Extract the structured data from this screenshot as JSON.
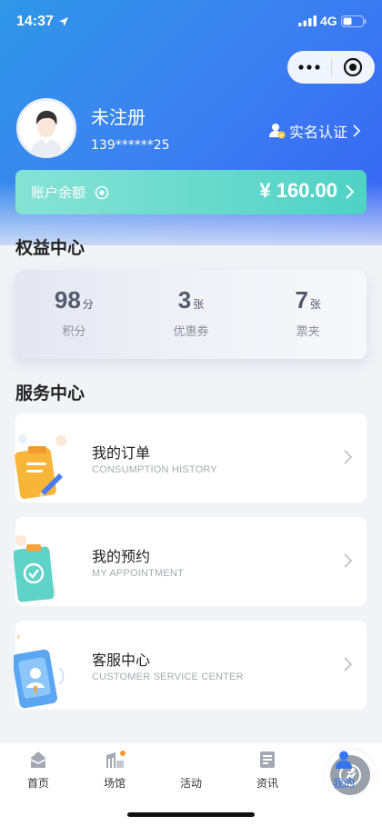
{
  "status_bar": {
    "time": "14:37",
    "network": "4G"
  },
  "user": {
    "name": "未注册",
    "phone": "139******25",
    "verify_label": "实名认证"
  },
  "balance": {
    "label": "账户余额",
    "amount": "¥ 160.00"
  },
  "rights": {
    "title": "权益中心",
    "stats": [
      {
        "value": "98",
        "unit": "分",
        "label": "积分"
      },
      {
        "value": "3",
        "unit": "张",
        "label": "优惠券"
      },
      {
        "value": "7",
        "unit": "张",
        "label": "票夹"
      }
    ]
  },
  "services": {
    "title": "服务中心",
    "items": [
      {
        "title": "我的订单",
        "subtitle": "CONSUMPTION HISTORY"
      },
      {
        "title": "我的预约",
        "subtitle": "MY APPOINTMENT"
      },
      {
        "title": "客服中心",
        "subtitle": "CUSTOMER SERVICE CENTER"
      }
    ]
  },
  "tabbar": {
    "items": [
      {
        "label": "首页",
        "icon": "home-icon"
      },
      {
        "label": "场馆",
        "icon": "stadium-icon"
      },
      {
        "label": "活动",
        "icon": "activity-icon"
      },
      {
        "label": "资讯",
        "icon": "news-icon"
      },
      {
        "label": "我的",
        "icon": "profile-icon"
      }
    ],
    "active_color": "#3476f1"
  },
  "colors": {
    "header_gradient_start": "#2f97e8",
    "header_gradient_end": "#3764f4",
    "balance_gradient_start": "#86e3d4",
    "balance_gradient_end": "#4fd2c5"
  }
}
